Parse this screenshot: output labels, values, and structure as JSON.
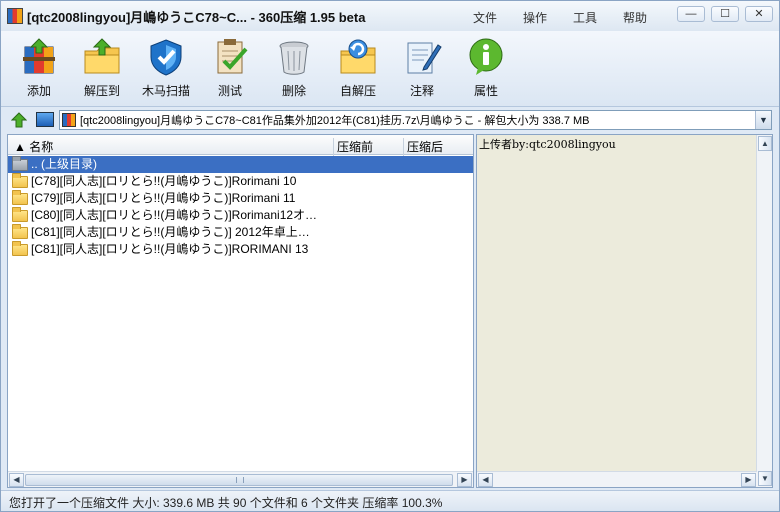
{
  "title": "[qtc2008lingyou]月嶋ゆうこC78~C... - 360压缩 1.95 beta",
  "menu": [
    "文件",
    "操作",
    "工具",
    "帮助"
  ],
  "window_controls": [
    "—",
    "☐",
    "✕"
  ],
  "toolbar": [
    {
      "label": "添加",
      "icon": "add-archive-icon"
    },
    {
      "label": "解压到",
      "icon": "extract-to-icon"
    },
    {
      "label": "木马扫描",
      "icon": "trojan-scan-shield-icon"
    },
    {
      "label": "测试",
      "icon": "test-checklist-icon"
    },
    {
      "label": "删除",
      "icon": "delete-trash-icon"
    },
    {
      "label": "自解压",
      "icon": "self-extract-icon"
    },
    {
      "label": "注释",
      "icon": "comment-note-icon"
    },
    {
      "label": "属性",
      "icon": "info-icon"
    }
  ],
  "address": {
    "path": "[qtc2008lingyou]月嶋ゆうこC78~C81作品集外加2012年(C81)挂历.7z\\月嶋ゆうこ - 解包大小为 338.7 MB"
  },
  "columns": {
    "name": "▲ 名称",
    "before": "压缩前",
    "after": "压缩后"
  },
  "files": [
    {
      "name": ".. (上级目录)",
      "selected": true,
      "type": "parent"
    },
    {
      "name": "[C78][同人志][ロリとら!!(月嶋ゆうこ)]Rorimani 10",
      "type": "folder"
    },
    {
      "name": "[C79][同人志][ロリとら!!(月嶋ゆうこ)]Rorimani 11",
      "type": "folder"
    },
    {
      "name": "[C80][同人志][ロリとら!!(月嶋ゆうこ)]Rorimani12オ…",
      "type": "folder"
    },
    {
      "name": "[C81][同人志][ロリとら!!(月嶋ゆうこ)] 2012年卓上…",
      "type": "folder"
    },
    {
      "name": "[C81][同人志][ロリとら!!(月嶋ゆうこ)]RORIMANI 13",
      "type": "folder"
    }
  ],
  "comment": "上传者by:qtc2008lingyou",
  "status": "您打开了一个压缩文件 大小: 339.6 MB 共 90 个文件和 6 个文件夹 压缩率 100.3%",
  "colors": {
    "selection": "#3b6fc3",
    "comment_bg": "#ecebdc",
    "frame": "#dfe9f5"
  }
}
